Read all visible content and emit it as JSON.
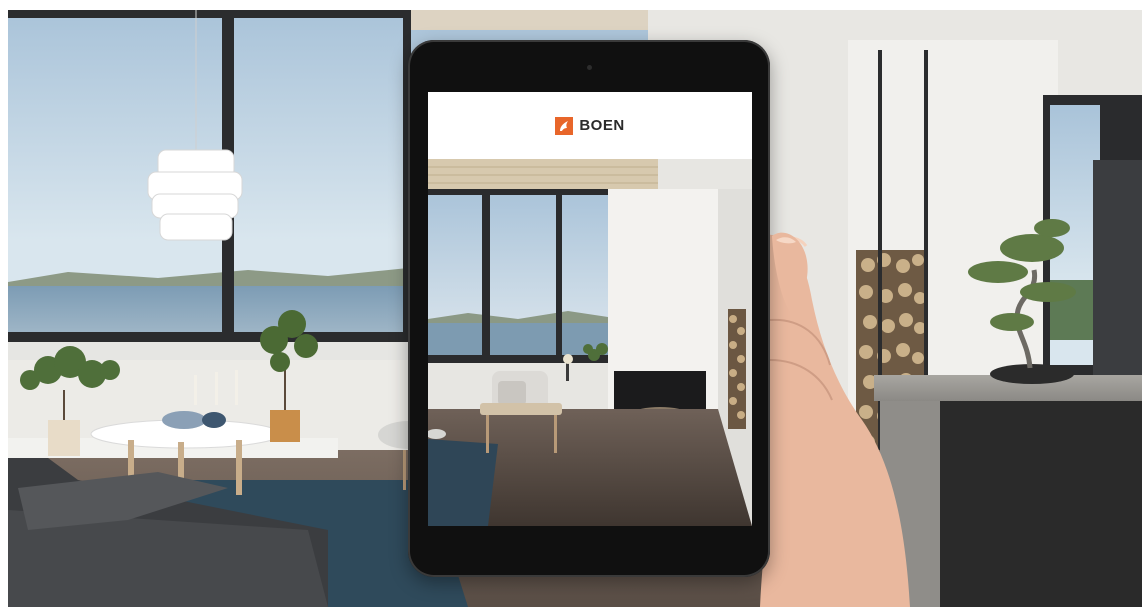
{
  "app": {
    "brand_name": "BOEN",
    "brand_color": "#e8662a",
    "logo_icon": "flame-leaf-logo-icon"
  },
  "scene": {
    "description_icons": [
      "pendant-lamp",
      "coffee-table",
      "sofa",
      "bonsai-tree",
      "fireplace",
      "firewood-rack",
      "kitchen-island"
    ]
  }
}
